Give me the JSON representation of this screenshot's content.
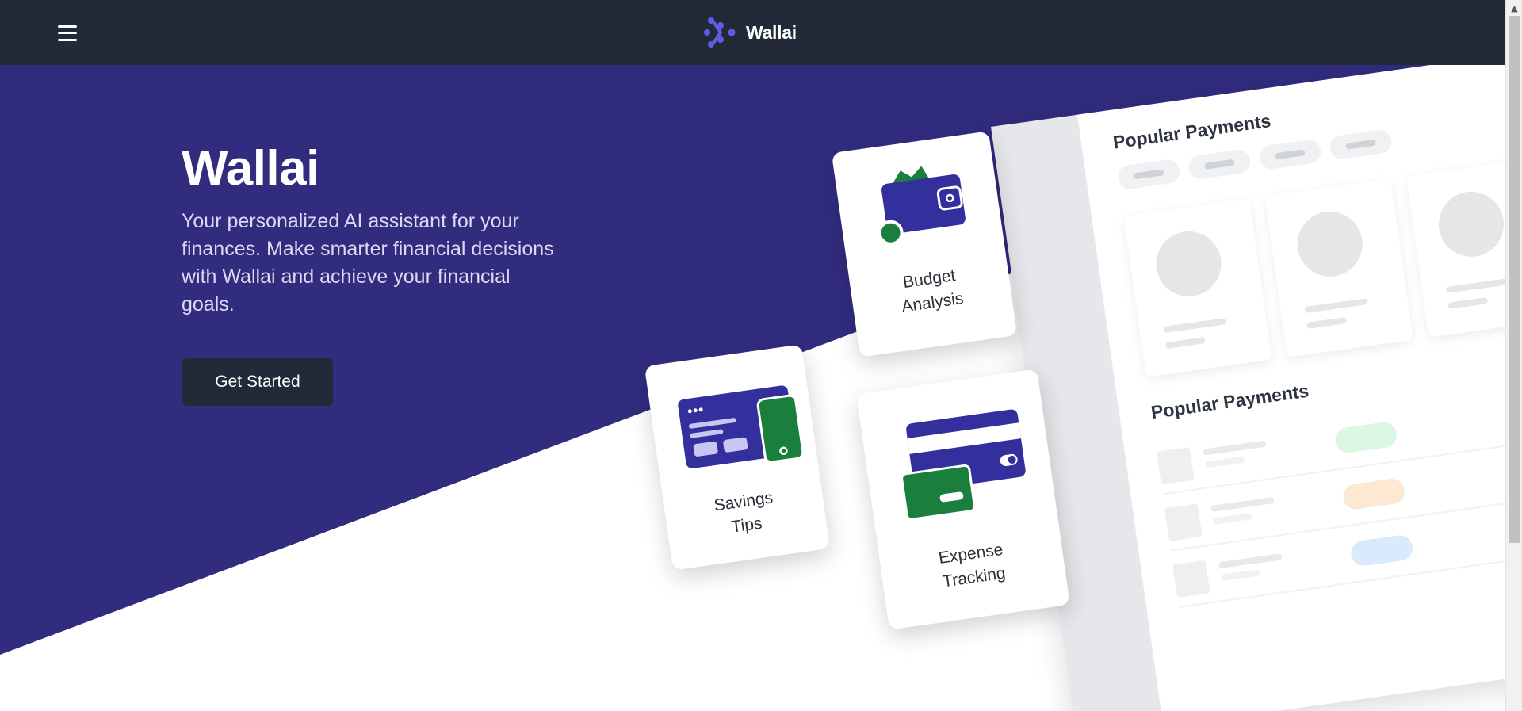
{
  "nav": {
    "brand_name": "Wallai",
    "icons": {
      "menu": "hamburger-menu-icon",
      "logo": "wallai-logo-icon"
    },
    "colors": {
      "background": "#222a37",
      "logo_accent": "#5f5ce6"
    }
  },
  "hero": {
    "title": "Wallai",
    "description": "Your personalized AI assistant for your finances. Make smarter financial decisions with Wallai and achieve your financial goals.",
    "cta_label": "Get Started",
    "colors": {
      "background": "#322c7f",
      "text": "#ffffff",
      "cta_bg": "#222a37"
    }
  },
  "features": [
    {
      "label": "Budget\nAnalysis",
      "icon": "wallet-icon"
    },
    {
      "label": "Savings\nTips",
      "icon": "card-and-phone-icon"
    },
    {
      "label": "Expense\nTracking",
      "icon": "credit-cards-icon"
    }
  ],
  "mock_dashboard": {
    "section_heading_1": "Popular Payments",
    "section_heading_2": "Popular Payments",
    "badge_colors": [
      "#dcf7e4",
      "#fde9d3",
      "#dbe9fd"
    ]
  },
  "scrollbar": {
    "up_arrow": "▲"
  }
}
